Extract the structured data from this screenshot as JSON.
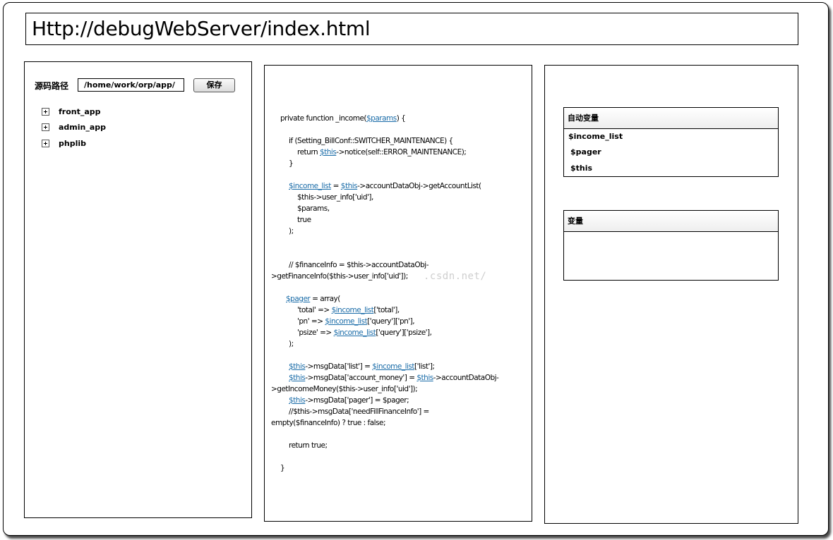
{
  "address_bar": {
    "url": "Http://debugWebServer/index.html"
  },
  "left_panel": {
    "source_path_label": "源码路径",
    "source_path_value": "/home/work/orp/app/",
    "save_label": "保存",
    "tree_items": [
      "front_app",
      "admin_app",
      "phplib"
    ]
  },
  "code": {
    "lines": [
      "private function _income($params) {",
      "if (Setting_BillConf::SWITCHER_MAINTENANCE) {",
      "return $this->notice(self::ERROR_MAINTENANCE);",
      "}",
      "$income_list = $this->accountDataObj->getAccountList(",
      "$this->user_info['uid'],",
      "$params,",
      "true",
      ");",
      "// $financeInfo = $this->accountDataObj-",
      ">getFinanceInfo($this->user_info['uid']);",
      "$pager = array(",
      "'total' => $income_list['total'],",
      "'pn' => $income_list['query']['pn'],",
      "'psize' => $income_list['query']['psize'],",
      ");",
      "$this->msgData['list'] = $income_list['list'];",
      "$this->msgData['account_money'] = $this->accountDataObj-",
      ">getIncomeMoney($this->user_info['uid']);",
      "$this->msgData['pager'] = $pager;",
      "//$this->msgData['needFillFinanceInfo'] =",
      "empty($financeInfo) ? true : false;",
      "return true;",
      "}"
    ]
  },
  "watermark": {
    "text": ".csdn.net/"
  },
  "right_panel": {
    "auto_vars": {
      "title": "自动变量",
      "items": [
        "$income_list",
        "$pager",
        "$this"
      ]
    },
    "vars": {
      "title": "变量",
      "items": []
    }
  }
}
